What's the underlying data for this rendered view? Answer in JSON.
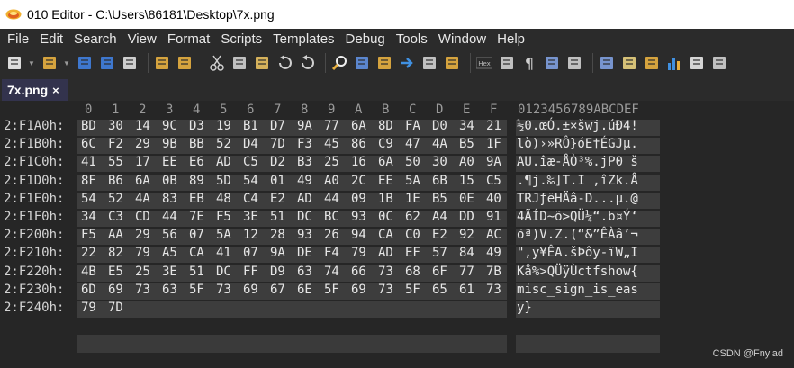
{
  "window": {
    "title": "010 Editor - C:\\Users\\86181\\Desktop\\7x.png"
  },
  "menu": [
    "File",
    "Edit",
    "Search",
    "View",
    "Format",
    "Scripts",
    "Templates",
    "Debug",
    "Tools",
    "Window",
    "Help"
  ],
  "toolbar_icons": [
    "new-file-icon",
    "open-folder-icon",
    "save-icon",
    "save-all-icon",
    "close-file-icon",
    "open-project-icon",
    "open-workspace-icon",
    "cut-icon",
    "copy-icon",
    "paste-icon",
    "undo-icon",
    "redo-icon",
    "find-icon",
    "replace-icon",
    "find-in-files-icon",
    "goto-icon",
    "templates-icon",
    "script-icon",
    "hex-mode-icon",
    "text-mode-icon",
    "paragraph-icon",
    "columns-icon",
    "check-icon",
    "calculator-icon",
    "inspector-icon",
    "compare-icon",
    "histogram-icon",
    "checksum-icon",
    "more-icon"
  ],
  "tab": {
    "label": "7x.png",
    "close": "×"
  },
  "columns": {
    "hex": [
      "0",
      "1",
      "2",
      "3",
      "4",
      "5",
      "6",
      "7",
      "8",
      "9",
      "A",
      "B",
      "C",
      "D",
      "E",
      "F"
    ],
    "ascii_header": "0123456789ABCDEF"
  },
  "rows": [
    {
      "addr": "2:F1A0h:",
      "hex": [
        "BD",
        "30",
        "14",
        "9C",
        "D3",
        "19",
        "B1",
        "D7",
        "9A",
        "77",
        "6A",
        "8D",
        "FA",
        "D0",
        "34",
        "21"
      ],
      "ascii": "½0.œÓ.±×šwj.úÐ4!"
    },
    {
      "addr": "2:F1B0h:",
      "hex": [
        "6C",
        "F2",
        "29",
        "9B",
        "BB",
        "52",
        "D4",
        "7D",
        "F3",
        "45",
        "86",
        "C9",
        "47",
        "4A",
        "B5",
        "1F"
      ],
      "ascii": "lò)›»RÔ}óE†ÉGJµ."
    },
    {
      "addr": "2:F1C0h:",
      "hex": [
        "41",
        "55",
        "17",
        "EE",
        "E6",
        "AD",
        "C5",
        "D2",
        "B3",
        "25",
        "16",
        "6A",
        "50",
        "30",
        "A0",
        "9A"
      ],
      "ascii": "AU.îæ-ÅÒ³%.jP0 š"
    },
    {
      "addr": "2:F1D0h:",
      "hex": [
        "8F",
        "B6",
        "6A",
        "0B",
        "89",
        "5D",
        "54",
        "01",
        "49",
        "A0",
        "2C",
        "EE",
        "5A",
        "6B",
        "15",
        "C5"
      ],
      "ascii": ".¶j.‰]T.I ,îZk.Å"
    },
    {
      "addr": "2:F1E0h:",
      "hex": [
        "54",
        "52",
        "4A",
        "83",
        "EB",
        "48",
        "C4",
        "E2",
        "AD",
        "44",
        "09",
        "1B",
        "1E",
        "B5",
        "0E",
        "40"
      ],
      "ascii": "TRJƒëHÄâ-D...µ.@"
    },
    {
      "addr": "2:F1F0h:",
      "hex": [
        "34",
        "C3",
        "CD",
        "44",
        "7E",
        "F5",
        "3E",
        "51",
        "DC",
        "BC",
        "93",
        "0C",
        "62",
        "A4",
        "DD",
        "91"
      ],
      "ascii": "4ÃÍD~õ>QÜ¼“.b¤Ý‘"
    },
    {
      "addr": "2:F200h:",
      "hex": [
        "F5",
        "AA",
        "29",
        "56",
        "07",
        "5A",
        "12",
        "28",
        "93",
        "26",
        "94",
        "CA",
        "C0",
        "E2",
        "92",
        "AC"
      ],
      "ascii": "õª)V.Z.(“&”ÊÀâ’¬"
    },
    {
      "addr": "2:F210h:",
      "hex": [
        "22",
        "82",
        "79",
        "A5",
        "CA",
        "41",
        "07",
        "9A",
        "DE",
        "F4",
        "79",
        "AD",
        "EF",
        "57",
        "84",
        "49"
      ],
      "ascii": "\"‚y¥ÊA.šÞôy-ïW„I"
    },
    {
      "addr": "2:F220h:",
      "hex": [
        "4B",
        "E5",
        "25",
        "3E",
        "51",
        "DC",
        "FF",
        "D9",
        "63",
        "74",
        "66",
        "73",
        "68",
        "6F",
        "77",
        "7B"
      ],
      "ascii": "Kå%>QÜÿÙctfshow{"
    },
    {
      "addr": "2:F230h:",
      "hex": [
        "6D",
        "69",
        "73",
        "63",
        "5F",
        "73",
        "69",
        "67",
        "6E",
        "5F",
        "69",
        "73",
        "5F",
        "65",
        "61",
        "73"
      ],
      "ascii": "misc_sign_is_eas"
    },
    {
      "addr": "2:F240h:",
      "hex": [
        "79",
        "7D"
      ],
      "ascii": "y}"
    }
  ],
  "watermark": "CSDN @Fnylad"
}
